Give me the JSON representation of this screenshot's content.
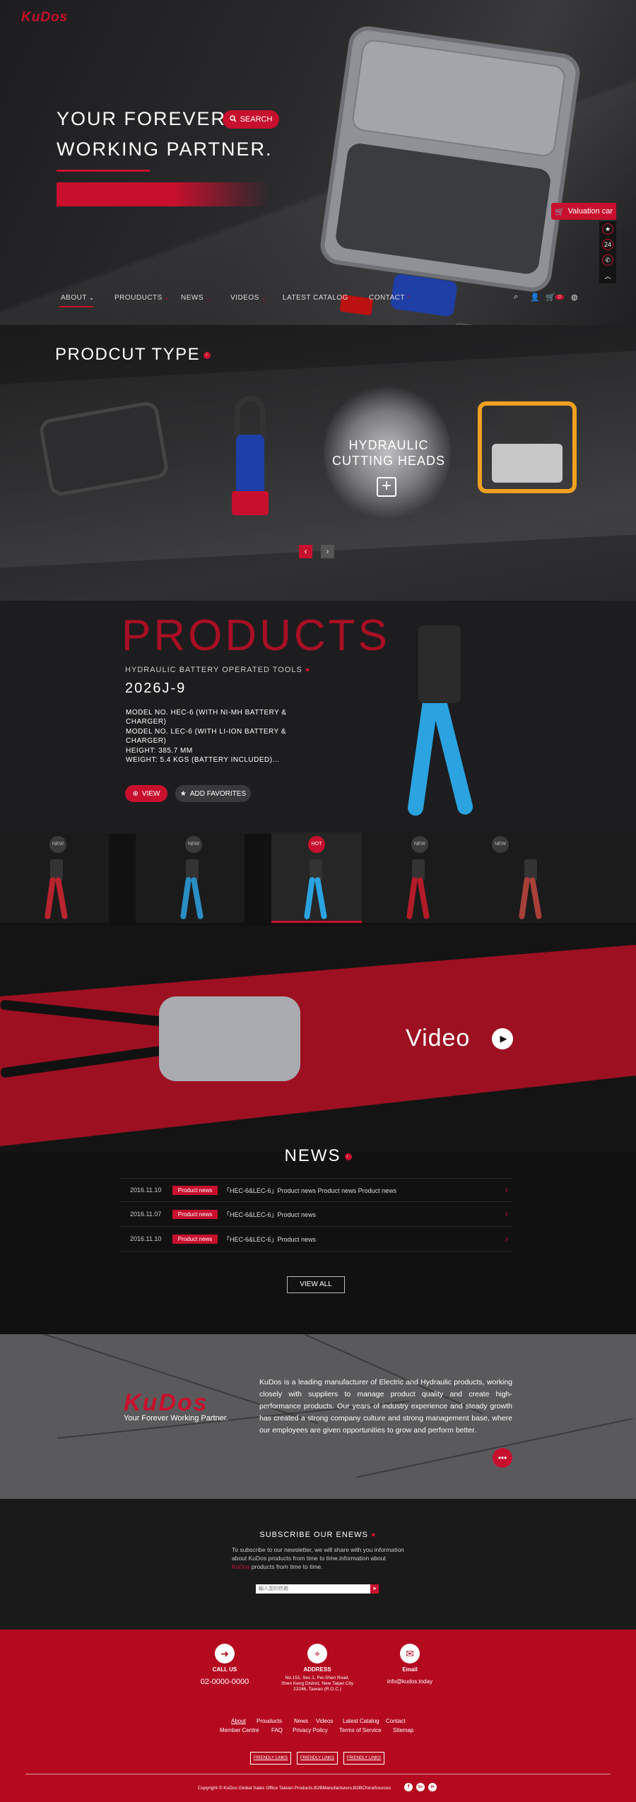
{
  "brand": {
    "logo": "KuDos"
  },
  "hero": {
    "line1": "YOUR FOREVER",
    "line2": "WORKING PARTNER.",
    "search_label": "SEARCH"
  },
  "widgets": {
    "valuation": "Valuation car",
    "icons": [
      "star-badge-icon",
      "24h-icon",
      "phone-icon",
      "chevron-up-icon"
    ]
  },
  "nav": {
    "items": [
      {
        "label": "ABOUT",
        "active": true
      },
      {
        "label": "PROUDUCTS"
      },
      {
        "label": "NEWS"
      },
      {
        "label": "VIDEOS"
      },
      {
        "label": "LATEST CATALOG"
      },
      {
        "label": "CONTACT"
      }
    ],
    "cart_count": "0"
  },
  "product_type": {
    "title": "PRODCUT TYPE",
    "featured_line1": "HYDRAULIC",
    "featured_line2": "CUTTING HEADS"
  },
  "products": {
    "heading": "PRODUCTS",
    "category": "HYDRAULIC BATTERY OPERATED TOOLS",
    "model": "2026J-9",
    "specs": [
      "MODEL NO. HEC-6 (WITH NI-MH BATTERY &",
      "CHARGER)",
      "MODEL NO. LEC-6 (WITH LI-ION BATTERY &",
      "CHARGER)",
      "HEIGHT: 385.7 MM",
      "WEIGHT: 5.4 KGS (BATTERY INCLUDED)..."
    ],
    "view_label": "VIEW",
    "fav_label": "ADD  FAVORITES",
    "thumbs": [
      {
        "badge": "NEW",
        "color": "#b8242e"
      },
      {
        "badge": "NEW",
        "color": "#2a8ec4"
      },
      {
        "badge": "HOT",
        "color": "#2aa3e0"
      },
      {
        "badge": "NEW",
        "color": "#b11c28"
      },
      {
        "badge": "NEW",
        "color": "#a8403a"
      }
    ]
  },
  "video": {
    "label": "Video"
  },
  "news": {
    "title": "NEWS",
    "items": [
      {
        "date": "2016.11.10",
        "tag": "Product news",
        "text": "「HEC-6&LEC-6」Product news Product news Product news"
      },
      {
        "date": "2016.11.07",
        "tag": "Product news",
        "text": "「HEC-6&LEC-6」Product news"
      },
      {
        "date": "2016.11.10",
        "tag": "Product news",
        "text": "「HEC-6&LEC-6」Product news"
      }
    ],
    "view_all": "VIEW ALL"
  },
  "about": {
    "logo": "KuDos",
    "tagline": "Your Forever Working Partner.",
    "text": "KuDos is a leading manufacturer of Electric and Hydraulic products, working closely with suppliers to manage product quality and create high-performance products. Our years of industry experience and steady growth has created a strong company culture and strong management base, where our employees are given opportunities to grow and perform better."
  },
  "subscribe": {
    "title": "SUBSCRIBE OUR ENEWS",
    "text_a": "To subscribe to our newsletter, we will share with you information about KuDos products from time to time.information about",
    "text_brand": "KuDos",
    "text_b": "products from time to time.",
    "placeholder": "輸入您的信箱"
  },
  "footer": {
    "call_label": "CALL US",
    "phone": "02-0000-0000",
    "address_label": "ADDRESS",
    "address_lines": [
      "No.151, Sec.1, Pei-Shen Road,",
      "Shen Keng District, New Taipei City",
      "22246, Taiwan (R.O.C.)"
    ],
    "email_label": "Email",
    "email": "info@kudos.today",
    "links_row1": [
      "About",
      "Prouducts",
      "News",
      "Videos",
      "Latest Catalog",
      "Contact"
    ],
    "links_row2": [
      "Member Centre",
      "FAQ",
      "Privacy Policy",
      "Terms of Service",
      "Sitemap"
    ],
    "friendly": [
      "FRIENDLY LINKS",
      "FRIENDLY LINKS",
      "FRIENDLY LINKS"
    ],
    "copyright": "Copyright © KuDos Global Sales Office Taiwan Products,B2BManufacturers,B2BChinaSources",
    "social": [
      "f",
      "G+",
      "in"
    ]
  }
}
